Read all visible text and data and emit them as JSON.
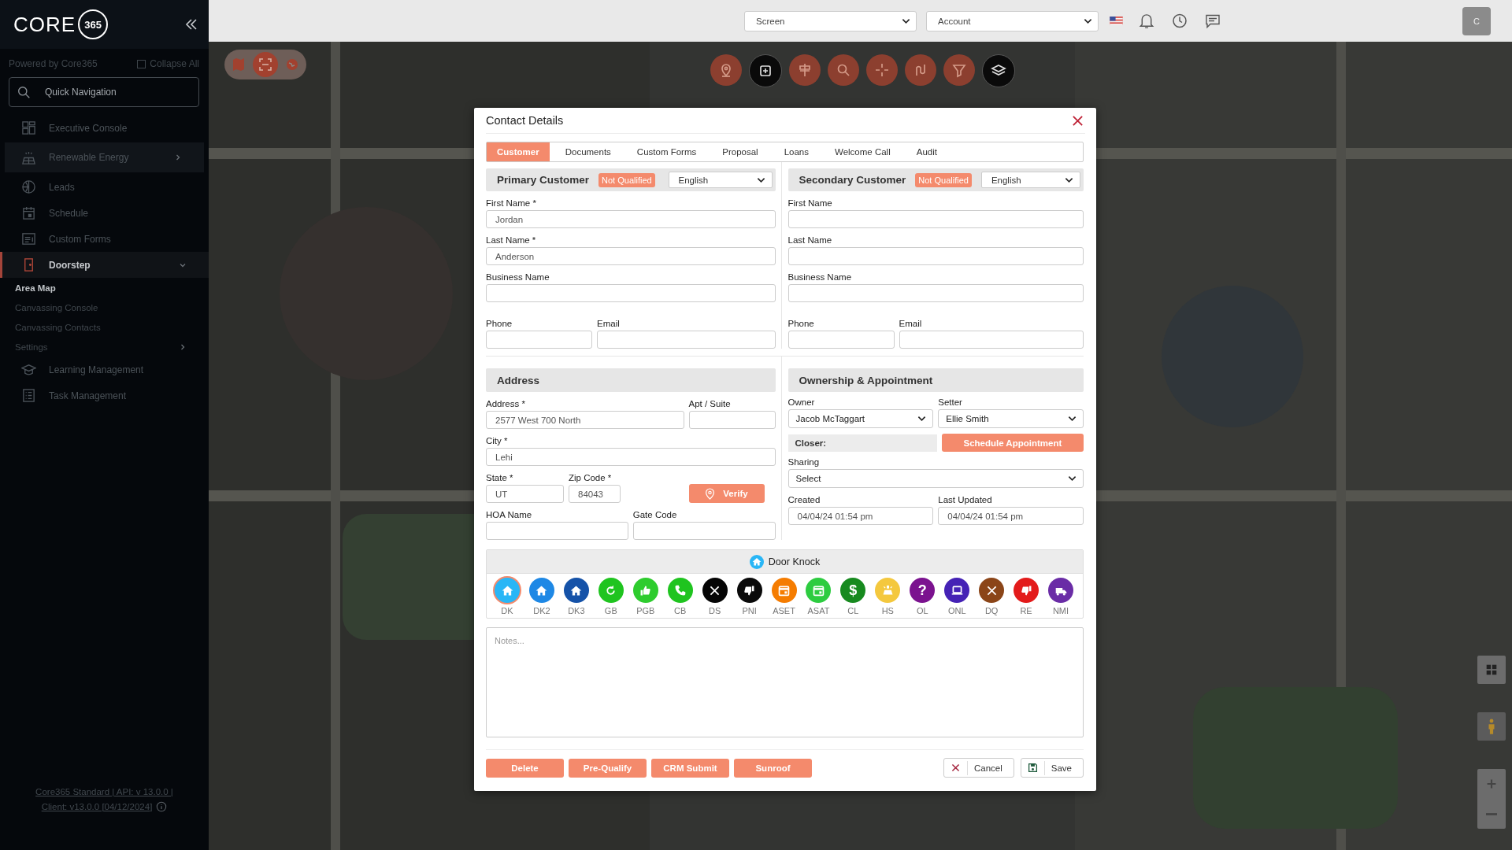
{
  "sidebar": {
    "logo": {
      "word": "CORE",
      "badge": "365"
    },
    "powered_by": "Powered by Core365",
    "collapse_all": "Collapse All",
    "search": {
      "placeholder": "Quick Navigation"
    },
    "items": [
      {
        "label": "Executive Console",
        "kind": "link",
        "selected": false,
        "highlighted": false
      },
      {
        "label": "Renewable Energy",
        "kind": "group",
        "expanded": false,
        "selected": false,
        "highlighted": true
      },
      {
        "label": "Leads",
        "kind": "link",
        "selected": false,
        "highlighted": false
      },
      {
        "label": "Schedule",
        "kind": "link",
        "selected": false,
        "highlighted": false
      },
      {
        "label": "Custom Forms",
        "kind": "link",
        "selected": false,
        "highlighted": false
      },
      {
        "label": "Doorstep",
        "kind": "group",
        "expanded": true,
        "selected": true,
        "highlighted": false,
        "children": [
          {
            "label": "Area Map",
            "kind": "link",
            "selected": true
          },
          {
            "label": "Canvassing Console",
            "kind": "link",
            "selected": false
          },
          {
            "label": "Canvassing Contacts",
            "kind": "link",
            "selected": false
          },
          {
            "label": "Settings",
            "kind": "group",
            "expanded": false,
            "selected": false
          }
        ]
      },
      {
        "label": "Learning Management",
        "kind": "link",
        "selected": false,
        "highlighted": false
      },
      {
        "label": "Task Management",
        "kind": "link",
        "selected": false,
        "highlighted": false
      }
    ],
    "footer": {
      "line1": "Core365 Standard | API: v 13.0.0 |",
      "line2": "Client: v13.0.0 [04/12/2024]"
    }
  },
  "topbar": {
    "screen_select": "Screen",
    "account_select": "Account",
    "avatar": "C"
  },
  "modal": {
    "title": "Contact Details",
    "tabs": [
      {
        "label": "Customer",
        "selected": true
      },
      {
        "label": "Documents",
        "selected": false
      },
      {
        "label": "Custom Forms",
        "selected": false
      },
      {
        "label": "Proposal",
        "selected": false
      },
      {
        "label": "Loans",
        "selected": false
      },
      {
        "label": "Welcome Call",
        "selected": false
      },
      {
        "label": "Audit",
        "selected": false
      }
    ],
    "customers": [
      {
        "title": "Primary Customer",
        "status": "Not Qualified",
        "language": "English",
        "first_name": {
          "label": "First Name *",
          "value": "Jordan"
        },
        "last_name": {
          "label": "Last Name *",
          "value": "Anderson"
        },
        "business_name": {
          "label": "Business Name"
        },
        "phone": {
          "label": "Phone"
        },
        "email": {
          "label": "Email"
        }
      },
      {
        "title": "Secondary Customer",
        "status": "Not Qualified",
        "language": "English",
        "first_name": {
          "label": "First Name"
        },
        "last_name": {
          "label": "Last Name"
        },
        "business_name": {
          "label": "Business Name"
        },
        "phone": {
          "label": "Phone"
        },
        "email": {
          "label": "Email"
        }
      }
    ],
    "address": {
      "title": "Address",
      "address": {
        "label": "Address *",
        "value": "2577 West 700 North"
      },
      "apt": {
        "label": "Apt / Suite"
      },
      "city": {
        "label": "City *",
        "value": "Lehi"
      },
      "state": {
        "label": "State *",
        "value": "UT"
      },
      "zip": {
        "label": "Zip Code *",
        "value": "84043"
      },
      "verify_button": "Verify",
      "hoa": {
        "label": "HOA Name"
      },
      "gate_code": {
        "label": "Gate Code"
      }
    },
    "ownership": {
      "title": "Ownership & Appointment",
      "owner": {
        "label": "Owner",
        "value": "Jacob McTaggart"
      },
      "setter": {
        "label": "Setter",
        "value": "Ellie Smith"
      },
      "closer": "Closer:",
      "schedule_button": "Schedule Appointment",
      "sharing": {
        "label": "Sharing",
        "value": "Select"
      },
      "created": {
        "label": "Created",
        "value": "04/04/24 01:54 pm"
      },
      "last_updated": {
        "label": "Last Updated",
        "value": "04/04/24 01:54 pm"
      }
    },
    "door_knock": {
      "title": "Door Knock",
      "statuses": [
        {
          "code": "DK",
          "color": "#29b6f6",
          "selected": true
        },
        {
          "code": "DK2",
          "color": "#1e88e5",
          "selected": false
        },
        {
          "code": "DK3",
          "color": "#1552a8",
          "selected": false
        },
        {
          "code": "GB",
          "color": "#1fc41f",
          "selected": false
        },
        {
          "code": "PGB",
          "color": "#2ecc2e",
          "selected": false
        },
        {
          "code": "CB",
          "color": "#1fc41f",
          "selected": false
        },
        {
          "code": "DS",
          "color": "#050505",
          "selected": false
        },
        {
          "code": "PNI",
          "color": "#0a0a0a",
          "selected": false
        },
        {
          "code": "ASET",
          "color": "#f57c00",
          "selected": false
        },
        {
          "code": "ASAT",
          "color": "#2dcc40",
          "selected": false
        },
        {
          "code": "CL",
          "color": "#178a1f",
          "selected": false,
          "glyph": "$"
        },
        {
          "code": "HS",
          "color": "#f4c83e",
          "selected": false
        },
        {
          "code": "OL",
          "color": "#7b128f",
          "selected": false,
          "glyph": "?"
        },
        {
          "code": "ONL",
          "color": "#4522b5",
          "selected": false
        },
        {
          "code": "DQ",
          "color": "#8b4518",
          "selected": false
        },
        {
          "code": "RE",
          "color": "#e31b1b",
          "selected": false
        },
        {
          "code": "NMI",
          "color": "#6a2ca6",
          "selected": false
        }
      ]
    },
    "notes": {
      "placeholder": "Notes..."
    },
    "actions": [
      "Delete",
      "Pre-Qualify",
      "CRM Submit",
      "Sunroof"
    ],
    "cancel_button": "Cancel",
    "save_button": "Save"
  }
}
